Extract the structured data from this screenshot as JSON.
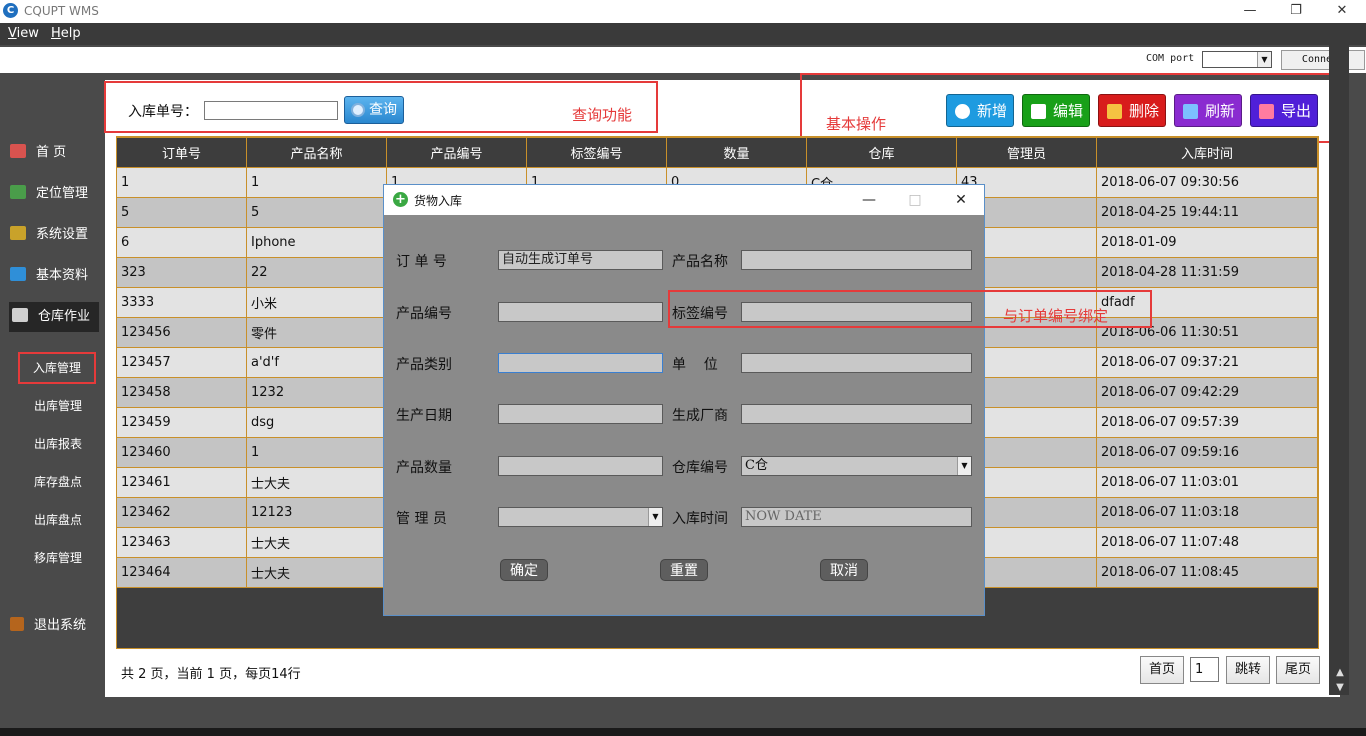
{
  "app": {
    "title": "CQUPT WMS",
    "logo_glyph": "C"
  },
  "window_controls": {
    "minimize": "—",
    "maximize": "❐",
    "close": "✕"
  },
  "menu": {
    "view_u": "V",
    "view_rest": "iew",
    "help_u": "H",
    "help_rest": "elp"
  },
  "comport": {
    "label": "COM port",
    "value": "",
    "connect_label": "Connect"
  },
  "sidebar": {
    "items": [
      {
        "label": "首  页",
        "icon": "home-icon",
        "color": "#d9534f"
      },
      {
        "label": "定位管理",
        "icon": "map-icon",
        "color": "#4a9d4a"
      },
      {
        "label": "系统设置",
        "icon": "tools-icon",
        "color": "#c9a22a"
      },
      {
        "label": "基本资料",
        "icon": "folder-icon",
        "color": "#2f8fd8"
      },
      {
        "label": "仓库作业",
        "icon": "book-icon",
        "color": "#cfcfcf"
      }
    ],
    "subitems": [
      "入库管理",
      "出库管理",
      "出库报表",
      "库存盘点",
      "出库盘点",
      "移库管理"
    ],
    "exit_label": "退出系统"
  },
  "search": {
    "label": "入库单号：",
    "value": "",
    "button_label": "查询"
  },
  "actions": [
    {
      "label": "新增",
      "icon": "plus-icon",
      "color": "#1e9be0"
    },
    {
      "label": "编辑",
      "icon": "edit-icon",
      "color": "#18a018"
    },
    {
      "label": "删除",
      "icon": "delete-icon",
      "color": "#d81c1c"
    },
    {
      "label": "刷新",
      "icon": "refresh-icon",
      "color": "#8a2bd0"
    },
    {
      "label": "导出",
      "icon": "export-icon",
      "color": "#5020d8"
    }
  ],
  "annotations": {
    "query": "查询功能",
    "basic_ops": "基本操作",
    "tag_binding": "与订单编号绑定"
  },
  "table": {
    "columns": [
      "订单号",
      "产品名称",
      "产品编号",
      "标签编号",
      "数量",
      "仓库",
      "管理员",
      "入库时间"
    ],
    "rows": [
      [
        "1",
        "1",
        "1",
        "1",
        "0",
        "C仓",
        "43",
        "2018-06-07 09:30:56"
      ],
      [
        "5",
        "5",
        "",
        "",
        "",
        "",
        "",
        "2018-04-25 19:44:11"
      ],
      [
        "6",
        "Iphone",
        "",
        "",
        "",
        "",
        "",
        "2018-01-09"
      ],
      [
        "323",
        "22",
        "",
        "",
        "",
        "",
        "",
        "2018-04-28 11:31:59"
      ],
      [
        "3333",
        "小米",
        "",
        "",
        "",
        "",
        "",
        "dfadf"
      ],
      [
        "123456",
        "零件",
        "",
        "",
        "",
        "",
        "",
        "2018-06-06 11:30:51"
      ],
      [
        "123457",
        "a'd'f",
        "",
        "",
        "",
        "",
        "",
        "2018-06-07 09:37:21"
      ],
      [
        "123458",
        "1232",
        "",
        "",
        "",
        "",
        "",
        "2018-06-07 09:42:29"
      ],
      [
        "123459",
        "dsg",
        "",
        "",
        "",
        "",
        "",
        "2018-06-07 09:57:39"
      ],
      [
        "123460",
        "1",
        "",
        "",
        "",
        "",
        "",
        "2018-06-07 09:59:16"
      ],
      [
        "123461",
        "士大夫",
        "",
        "",
        "",
        "",
        "",
        "2018-06-07 11:03:01"
      ],
      [
        "123462",
        "12123",
        "",
        "",
        "",
        "",
        "",
        "2018-06-07 11:03:18"
      ],
      [
        "123463",
        "士大夫",
        "",
        "",
        "",
        "",
        "",
        "2018-06-07 11:07:48"
      ],
      [
        "123464",
        "士大夫",
        "",
        "",
        "",
        "",
        "",
        "2018-06-07 11:08:45"
      ]
    ]
  },
  "pager": {
    "info": "共 2 页，当前 1 页，每页14行",
    "first": "首页",
    "page_value": "1",
    "jump": "跳转",
    "last": "尾页"
  },
  "dialog": {
    "title": "货物入库",
    "icon_glyph": "+",
    "fields": {
      "order_no_label": "订 单 号",
      "order_no_value": "自动生成订单号",
      "product_name_label": "产品名称",
      "product_name_value": "",
      "product_code_label": "产品编号",
      "product_code_value": "",
      "tag_code_label": "标签编号",
      "tag_code_value": "",
      "category_label": "产品类别",
      "category_value": "",
      "unit_label": "单    位",
      "unit_value": "",
      "prod_date_label": "生产日期",
      "prod_date_value": "",
      "maker_label": "生成厂商",
      "maker_value": "",
      "quantity_label": "产品数量",
      "quantity_value": "",
      "warehouse_label": "仓库编号",
      "warehouse_value": "C仓",
      "manager_label": "管 理 员",
      "manager_value": "",
      "time_label": "入库时间",
      "time_value": "NOW DATE"
    },
    "buttons": {
      "confirm": "确定",
      "reset": "重置",
      "cancel": "取消"
    }
  }
}
